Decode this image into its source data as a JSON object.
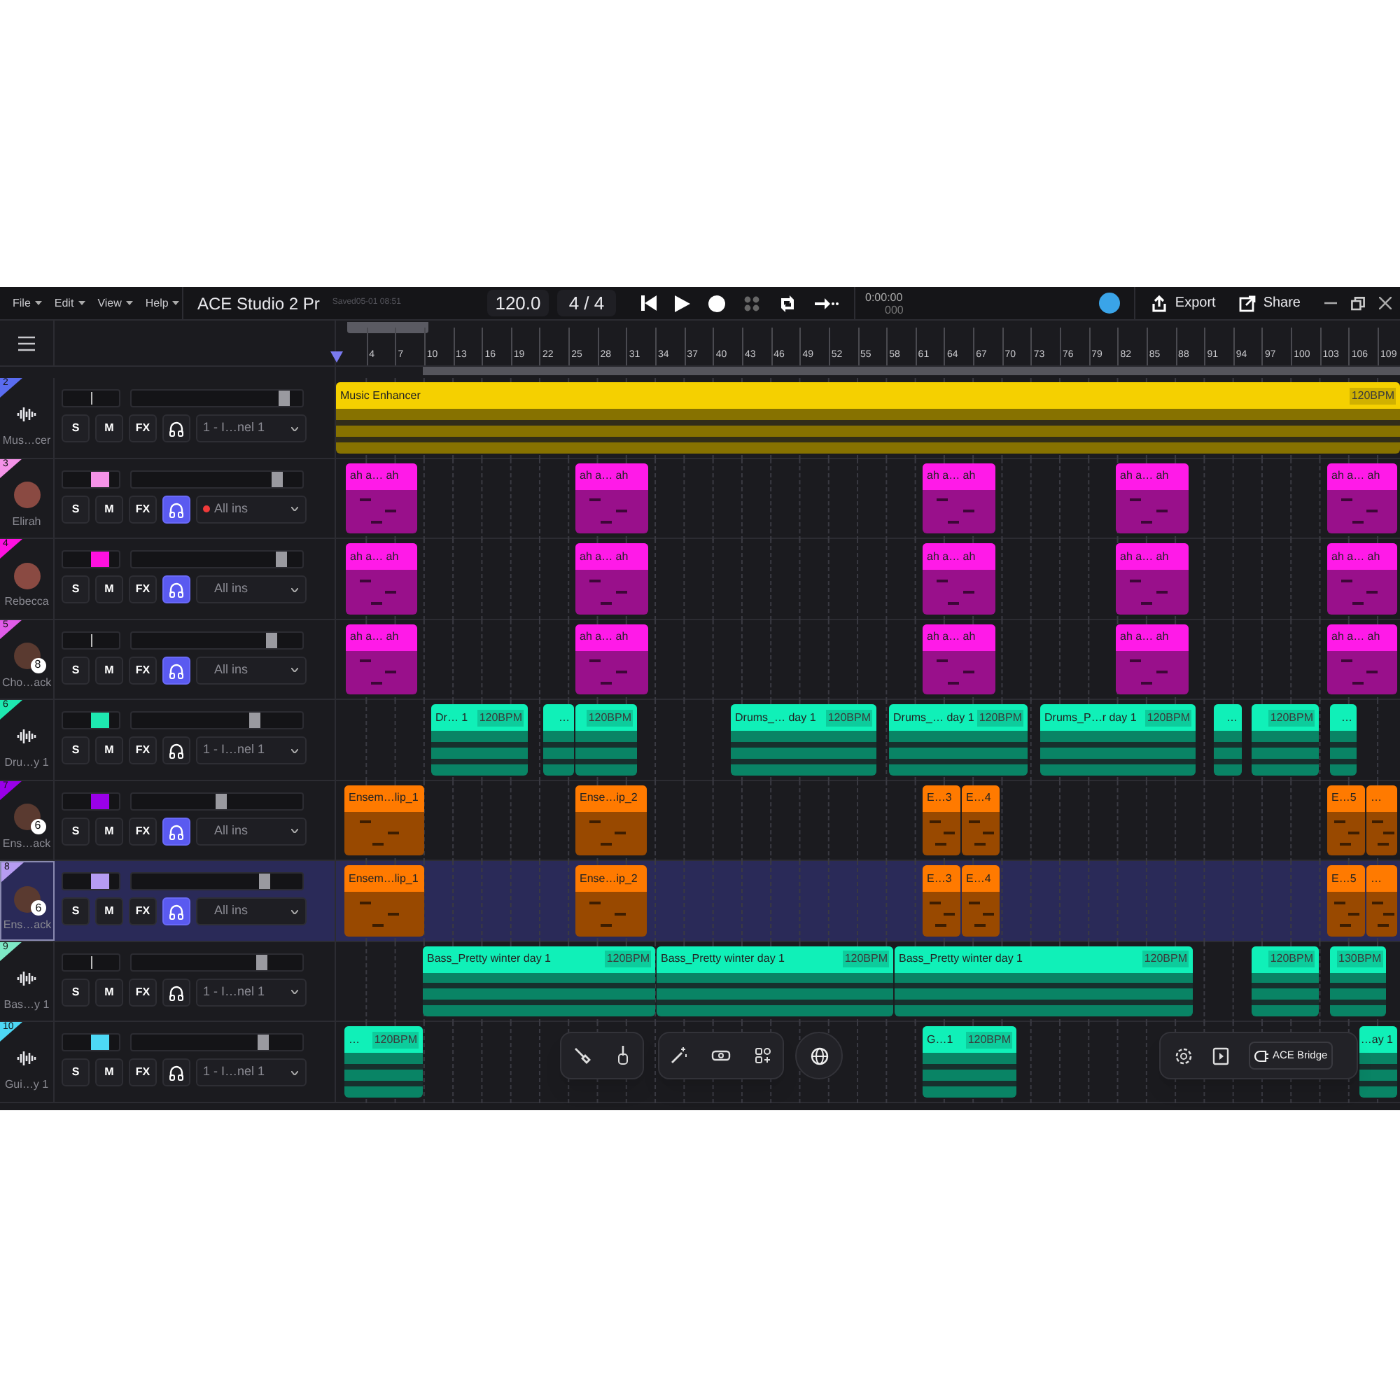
{
  "menu": [
    {
      "label": "File"
    },
    {
      "label": "Edit"
    },
    {
      "label": "View"
    },
    {
      "label": "Help"
    }
  ],
  "project": {
    "title": "ACE Studio 2 Pr",
    "saved": "Saved05-01 08:51"
  },
  "transport": {
    "tempo": "120.0",
    "time_signature": "4 / 4",
    "time": "0:00:00",
    "ticks": "000"
  },
  "actions": [
    {
      "kind": "export",
      "label": "Export"
    },
    {
      "kind": "share",
      "label": "Share"
    }
  ],
  "ruler": {
    "bars": [
      "4",
      "7",
      "10",
      "13",
      "16",
      "19",
      "22",
      "25",
      "28",
      "31",
      "34",
      "37",
      "40",
      "43",
      "46",
      "49",
      "52",
      "55",
      "58",
      "61",
      "64",
      "67",
      "70",
      "73",
      "76",
      "79",
      "82",
      "85",
      "88",
      "91",
      "94",
      "97",
      "100",
      "103",
      "106",
      "109"
    ]
  },
  "tracks": [
    {
      "number": "2",
      "name": "Mus…cer",
      "kind": "audio",
      "color": "#5a6cf0",
      "swatch": false,
      "level": 0.92,
      "buttons": [
        "S",
        "M",
        "FX"
      ],
      "monitor": false,
      "armed": false,
      "input": "1 - I…nel 1",
      "selected": false,
      "clips": [
        {
          "name": "Music Enhancer",
          "bpm": "120BPM",
          "color": "#f5d000"
        }
      ]
    },
    {
      "number": "3",
      "name": "Elirah",
      "kind": "singer",
      "color": "#f593e8",
      "swatch": true,
      "level": 0.88,
      "buttons": [
        "S",
        "M",
        "FX"
      ],
      "monitor": true,
      "armed": true,
      "input": "All ins",
      "selected": false,
      "clips": [
        {
          "name": "ah a… ah",
          "color": "#ff1ae8"
        },
        {
          "name": "ah a… ah",
          "color": "#ff1ae8"
        },
        {
          "name": "ah a… ah",
          "color": "#ff1ae8"
        },
        {
          "name": "ah a… ah",
          "color": "#ff1ae8"
        },
        {
          "name": "ah a… ah",
          "color": "#ff1ae8"
        }
      ]
    },
    {
      "number": "4",
      "name": "Rebecca",
      "kind": "singer",
      "color": "#ff10e0",
      "swatch": true,
      "level": 0.9,
      "buttons": [
        "S",
        "M",
        "FX"
      ],
      "monitor": true,
      "armed": false,
      "input": "All ins",
      "selected": false,
      "clips": [
        {
          "name": "ah a… ah",
          "color": "#ff1ae8"
        },
        {
          "name": "ah a… ah",
          "color": "#ff1ae8"
        },
        {
          "name": "ah a… ah",
          "color": "#ff1ae8"
        },
        {
          "name": "ah a… ah",
          "color": "#ff1ae8"
        },
        {
          "name": "ah a… ah",
          "color": "#ff1ae8"
        }
      ]
    },
    {
      "number": "5",
      "name": "Cho…ack",
      "kind": "singer",
      "badge": "8",
      "color": "#e05ce8",
      "swatch": false,
      "level": 0.84,
      "buttons": [
        "S",
        "M",
        "FX"
      ],
      "monitor": true,
      "armed": false,
      "input": "All ins",
      "selected": false,
      "clips": [
        {
          "name": "ah a… ah",
          "color": "#ff1ae8"
        },
        {
          "name": "ah a… ah",
          "color": "#ff1ae8"
        },
        {
          "name": "ah a… ah",
          "color": "#ff1ae8"
        },
        {
          "name": "ah a… ah",
          "color": "#ff1ae8"
        },
        {
          "name": "ah a… ah",
          "color": "#ff1ae8"
        }
      ]
    },
    {
      "number": "6",
      "name": "Dru…y 1",
      "kind": "audio",
      "color": "#1ee8b0",
      "swatch": true,
      "level": 0.74,
      "buttons": [
        "S",
        "M",
        "FX"
      ],
      "monitor": false,
      "armed": false,
      "input": "1 - I…nel 1",
      "selected": false,
      "clips": [
        {
          "name": "Dr… 1",
          "bpm": "120BPM",
          "color": "#10f0b8"
        },
        {
          "name": "…",
          "color": "#10f0b8"
        },
        {
          "bpm": "120BPM",
          "color": "#10f0b8"
        },
        {
          "name": "Drums_… day 1",
          "bpm": "120BPM",
          "color": "#10f0b8"
        },
        {
          "name": "Drums_… day 1",
          "bpm": "120BPM",
          "color": "#10f0b8"
        },
        {
          "name": "Drums_P…r day 1",
          "bpm": "120BPM",
          "color": "#10f0b8"
        },
        {
          "name": "…",
          "color": "#10f0b8"
        },
        {
          "bpm": "120BPM",
          "color": "#10f0b8"
        },
        {
          "name": "…",
          "color": "#10f0b8"
        }
      ]
    },
    {
      "number": "7",
      "name": "Ens…ack",
      "kind": "singer",
      "badge": "6",
      "color": "#9a00e8",
      "swatch": true,
      "level": 0.53,
      "buttons": [
        "S",
        "M",
        "FX"
      ],
      "monitor": true,
      "armed": false,
      "input": "All ins",
      "selected": false,
      "clips": [
        {
          "name": "Ensem…lip_1",
          "color": "#ff7a00"
        },
        {
          "name": "Ense…ip_2",
          "color": "#ff7a00"
        },
        {
          "name": "E…3",
          "color": "#ff7a00"
        },
        {
          "name": "E…4",
          "color": "#ff7a00"
        },
        {
          "name": "E…5",
          "color": "#ff7a00"
        },
        {
          "name": "…",
          "color": "#ff7a00"
        }
      ]
    },
    {
      "number": "8",
      "name": "Ens…ack",
      "kind": "singer",
      "badge": "6",
      "color": "#b69cf2",
      "swatch": true,
      "level": 0.8,
      "buttons": [
        "S",
        "M",
        "FX"
      ],
      "monitor": true,
      "armed": false,
      "input": "All ins",
      "selected": true,
      "clips": [
        {
          "name": "Ensem…lip_1",
          "color": "#ff7a00"
        },
        {
          "name": "Ense…ip_2",
          "color": "#ff7a00"
        },
        {
          "name": "E…3",
          "color": "#ff7a00"
        },
        {
          "name": "E…4",
          "color": "#ff7a00"
        },
        {
          "name": "E…5",
          "color": "#ff7a00"
        },
        {
          "name": "…",
          "color": "#ff7a00"
        }
      ]
    },
    {
      "number": "9",
      "name": "Bas…y 1",
      "kind": "audio",
      "color": "#7ee8c6",
      "swatch": false,
      "level": 0.78,
      "buttons": [
        "S",
        "M",
        "FX"
      ],
      "monitor": false,
      "armed": false,
      "input": "1 - I…nel 1",
      "selected": false,
      "clips": [
        {
          "name": "Bass_Pretty winter day 1",
          "bpm": "120BPM",
          "color": "#10f0b8"
        },
        {
          "name": "Bass_Pretty winter day 1",
          "bpm": "120BPM",
          "color": "#10f0b8"
        },
        {
          "name": "Bass_Pretty winter day 1",
          "bpm": "120BPM",
          "color": "#10f0b8"
        },
        {
          "bpm": "120BPM",
          "color": "#10f0b8"
        },
        {
          "bpm": "130BPM",
          "color": "#10f0b8"
        }
      ]
    },
    {
      "number": "10",
      "name": "Gui…y 1",
      "kind": "audio",
      "color": "#4dd8f5",
      "swatch": true,
      "level": 0.79,
      "buttons": [
        "S",
        "M",
        "FX"
      ],
      "monitor": false,
      "armed": false,
      "input": "1 - I…nel 1",
      "selected": false,
      "clips": [
        {
          "name": "…",
          "bpm": "120BPM",
          "color": "#10f0b8"
        },
        {
          "name": "G…1",
          "bpm": "120BPM",
          "color": "#10f0b8"
        },
        {
          "name": "…ay 1",
          "color": "#10f0b8"
        }
      ]
    }
  ],
  "bridge": {
    "label": "ACE Bridge"
  }
}
